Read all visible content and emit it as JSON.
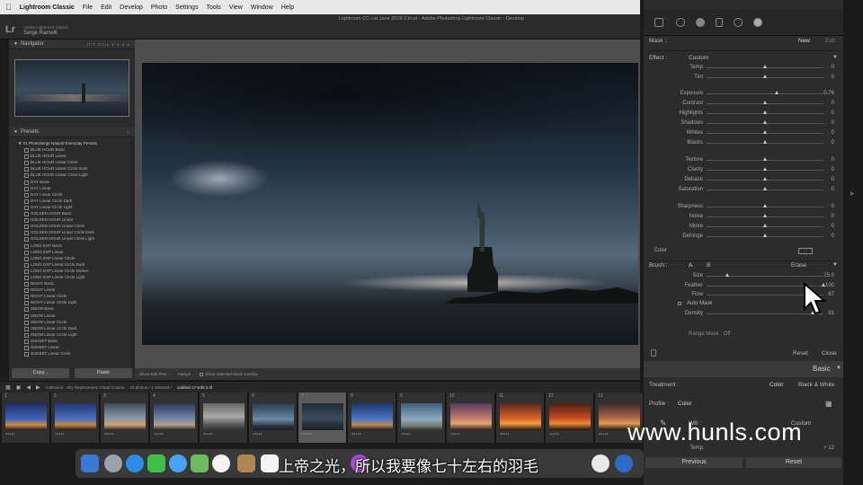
{
  "menubar": {
    "app_name": "Lightroom Classic",
    "items": [
      "File",
      "Edit",
      "Develop",
      "Photo",
      "Settings",
      "Tools",
      "View",
      "Window",
      "Help"
    ]
  },
  "titlebar": {
    "catalog": "Lightroom CC-cat June 2018-2.lrcat - Adobe Photoshop Lightroom Classic - Develop",
    "logo": "Lr",
    "adobe_line": "Adobe Lightroom Classic",
    "user": "Serge Ramelli"
  },
  "navigator": {
    "title": "Navigator",
    "zooms": "FIT FILL 1:1 3:1"
  },
  "presets": {
    "title": "Presets",
    "folder": "01 PhotoSerge Natural Everyday Presets",
    "items": [
      "BLUE HOUR Basic",
      "BLUE HOUR Linear",
      "BLUE HOUR Linear Circle",
      "BLUE HOUR Linear Circle Dark",
      "BLUE HOUR Linear Circle Light",
      "DAY Basic",
      "DAY Linear",
      "DAY Linear Circle",
      "DAY Linear Circle Dark",
      "DAY Linear Circle Light",
      "GOLDEN HOUR Basic",
      "GOLDEN HOUR Linear",
      "GOLDEN HOUR Linear Circle",
      "GOLDEN HOUR Linear Circle Dark",
      "GOLDEN HOUR Linear Circle Light",
      "LONG EXP Basic",
      "LONG EXP Linear",
      "LONG EXP Linear Circle",
      "LONG EXP Linear Circle Dark",
      "LONG EXP Linear Circle Darker",
      "LONG EXP Linear Circle Light",
      "NIGHT Basic",
      "NIGHT Linear",
      "NIGHT Linear Circle",
      "NIGHT Linear Circle Light",
      "SNOW Basic",
      "SNOW Linear",
      "SNOW Linear Circle",
      "SNOW Linear Circle Dark",
      "SNOW Linear Circle Light",
      "SUNSET Basic",
      "SUNSET Linear",
      "SUNSET Linear Circle"
    ],
    "copy_label": "Copy...",
    "paste_label": "Paste"
  },
  "center_toolbar": {
    "show_edit_pins": "Show Edit Pins :",
    "always": "Always",
    "show_overlay": "Show Selected Mask Overlay"
  },
  "filmbar": {
    "collection": "Collection : Sky Replacement Cheat Course",
    "count": "22 photos / 1 selected /",
    "filename": "untitled-17-Edit-2.tif"
  },
  "filmstrip": {
    "numbers": [
      "1",
      "2",
      "3",
      "4",
      "5",
      "6",
      "7",
      "8",
      "9",
      "10",
      "11",
      "12",
      "13"
    ],
    "selected_index": 6
  },
  "mask_panel": {
    "mask_label": "Mask :",
    "new_label": "New",
    "edit_label": "Edit",
    "effect_label": "Effect :",
    "effect_value": "Custom",
    "sliders": [
      {
        "label": "Temp",
        "value": "0",
        "pos": 0.5
      },
      {
        "label": "Tint",
        "value": "0",
        "pos": 0.5
      },
      {
        "label": "Exposure",
        "value": "0.76",
        "pos": 0.6
      },
      {
        "label": "Contrast",
        "value": "0",
        "pos": 0.5
      },
      {
        "label": "Highlights",
        "value": "0",
        "pos": 0.5
      },
      {
        "label": "Shadows",
        "value": "0",
        "pos": 0.5
      },
      {
        "label": "Whites",
        "value": "0",
        "pos": 0.5
      },
      {
        "label": "Blacks",
        "value": "0",
        "pos": 0.5
      },
      {
        "label": "Texture",
        "value": "0",
        "pos": 0.5
      },
      {
        "label": "Clarity",
        "value": "0",
        "pos": 0.5
      },
      {
        "label": "Dehaze",
        "value": "0",
        "pos": 0.5
      },
      {
        "label": "Saturation",
        "value": "0",
        "pos": 0.5
      },
      {
        "label": "Sharpness",
        "value": "0",
        "pos": 0.5
      },
      {
        "label": "Noise",
        "value": "0",
        "pos": 0.5
      },
      {
        "label": "Moire",
        "value": "0",
        "pos": 0.5
      },
      {
        "label": "Defringe",
        "value": "0",
        "pos": 0.5
      }
    ],
    "color_label": "Color"
  },
  "brush_panel": {
    "brush_label": "Brush :",
    "a_label": "A",
    "b_label": "B",
    "erase_label": "Erase",
    "sliders": [
      {
        "label": "Size",
        "value": "15.0",
        "pos": 0.18
      },
      {
        "label": "Feather",
        "value": "100",
        "pos": 1.0
      },
      {
        "label": "Flow",
        "value": "87",
        "pos": 0.87
      },
      {
        "label": "Density",
        "value": "91",
        "pos": 0.91
      }
    ],
    "auto_mask": "Auto Mask",
    "range_mask": "Range Mask : Off",
    "reset_label": "Reset",
    "close_label": "Close"
  },
  "basic_panel": {
    "title": "Basic",
    "treatment_label": "Treatment :",
    "color_label": "Color",
    "bw_label": "Black & White",
    "profile_label": "Profile :",
    "profile_value": "Color",
    "wb_label": "WB :",
    "wb_value": "Custom",
    "temp_label": "Temp",
    "temp_value": "+ 12"
  },
  "bottom_buttons": {
    "previous": "Previous",
    "reset": "Reset"
  },
  "overlay": {
    "watermark": "www.hunls.com",
    "subtitle": "上帝之光，所以我要像七十左右的羽毛"
  }
}
